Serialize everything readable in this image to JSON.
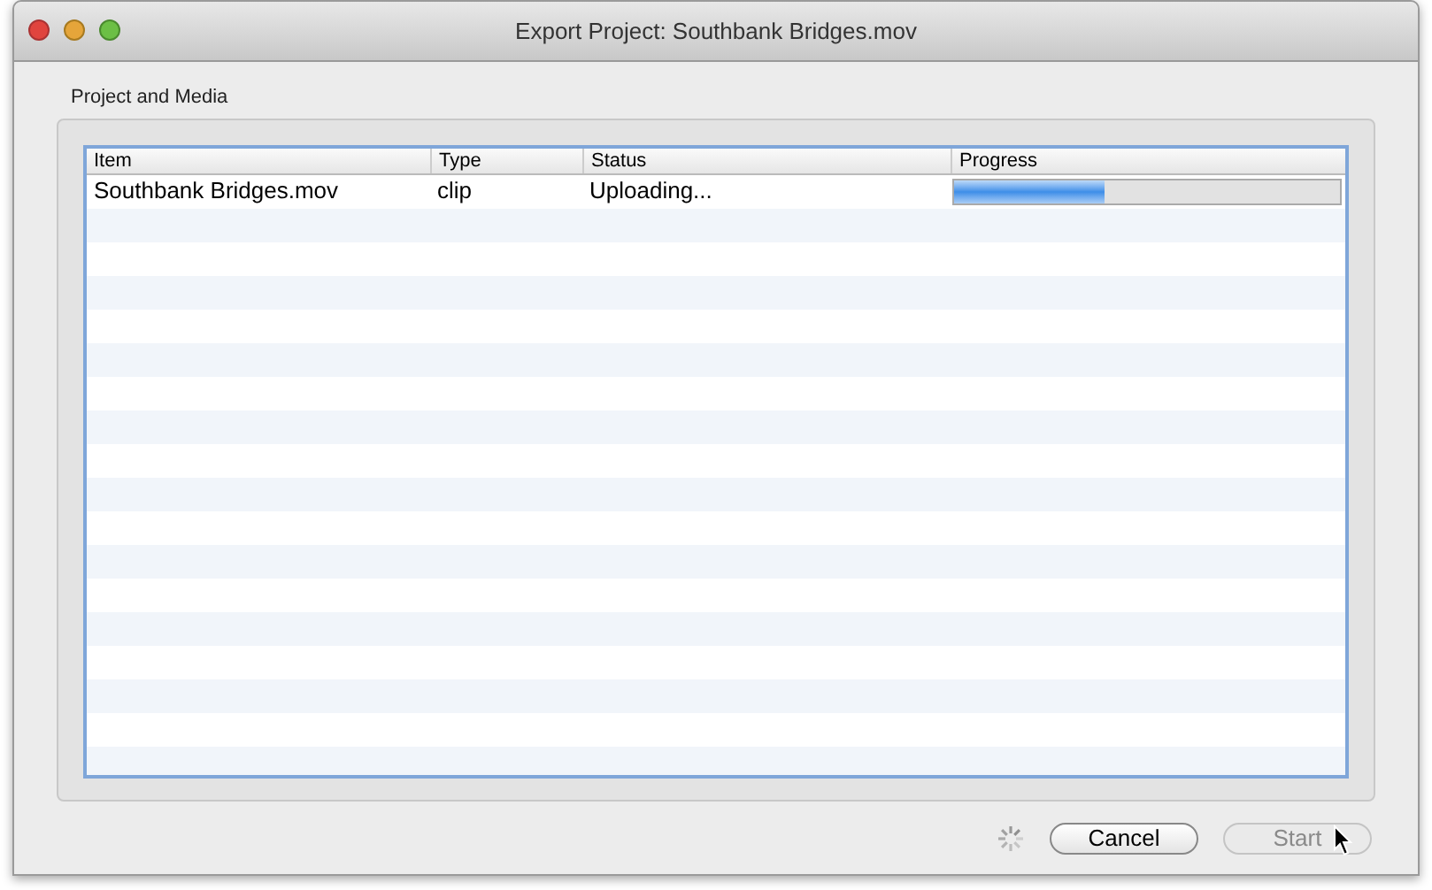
{
  "window": {
    "title": "Export Project: Southbank Bridges.mov"
  },
  "group": {
    "label": "Project and Media"
  },
  "table": {
    "columns": [
      "Item",
      "Type",
      "Status",
      "Progress"
    ],
    "rows": [
      {
        "item": "Southbank Bridges.mov",
        "type": "clip",
        "status": "Uploading...",
        "level": 0.39
      }
    ]
  },
  "busy": true,
  "buttons": [
    {
      "label": "Cancel",
      "disabled": false
    },
    {
      "label": "Start",
      "disabled": true
    }
  ]
}
